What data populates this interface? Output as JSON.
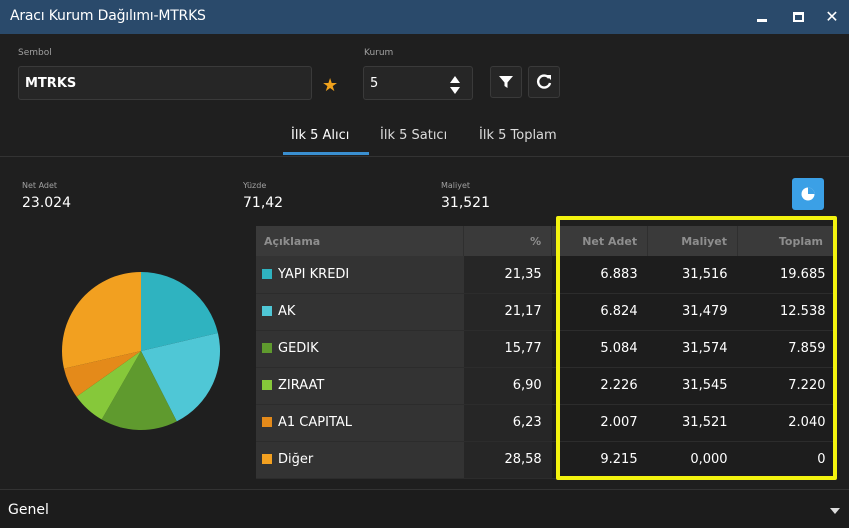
{
  "window": {
    "title": "Aracı Kurum Dağılımı-MTRKS"
  },
  "symbol": {
    "label": "Sembol",
    "value": "MTRKS"
  },
  "kurum": {
    "label": "Kurum",
    "value": "5"
  },
  "tabs": [
    {
      "label": "İlk 5 Alıcı",
      "active": true
    },
    {
      "label": "İlk 5 Satıcı",
      "active": false
    },
    {
      "label": "İlk 5 Toplam",
      "active": false
    }
  ],
  "stats": {
    "net_adet": {
      "label": "Net Adet",
      "value": "23.024"
    },
    "yuzde": {
      "label": "Yüzde",
      "value": "71,42"
    },
    "maliyet": {
      "label": "Maliyet",
      "value": "31,521"
    }
  },
  "table": {
    "headers": [
      "Açıklama",
      "%",
      "Net Adet",
      "Maliyet",
      "Toplam"
    ],
    "rows": [
      {
        "name": "YAPI KREDI",
        "pct": "21,35",
        "net": "6.883",
        "maliyet": "31,516",
        "toplam": "19.685",
        "color": "#2fb3c0"
      },
      {
        "name": "AK",
        "pct": "21,17",
        "net": "6.824",
        "maliyet": "31,479",
        "toplam": "12.538",
        "color": "#4fc7d6"
      },
      {
        "name": "GEDIK",
        "pct": "15,77",
        "net": "5.084",
        "maliyet": "31,574",
        "toplam": "7.859",
        "color": "#5f9a2e"
      },
      {
        "name": "ZIRAAT",
        "pct": "6,90",
        "net": "2.226",
        "maliyet": "31,545",
        "toplam": "7.220",
        "color": "#86c83a"
      },
      {
        "name": "A1 CAPITAL",
        "pct": "6,23",
        "net": "2.007",
        "maliyet": "31,521",
        "toplam": "2.040",
        "color": "#e48a1a"
      },
      {
        "name": "Diğer",
        "pct": "28,58",
        "net": "9.215",
        "maliyet": "0,000",
        "toplam": "0",
        "color": "#f2a020"
      }
    ]
  },
  "chart_data": {
    "type": "pie",
    "categories": [
      "YAPI KREDI",
      "AK",
      "GEDIK",
      "ZIRAAT",
      "A1 CAPITAL",
      "Diğer"
    ],
    "values": [
      21.35,
      21.17,
      15.77,
      6.9,
      6.23,
      28.58
    ],
    "colors": [
      "#2fb3c0",
      "#4fc7d6",
      "#5f9a2e",
      "#86c83a",
      "#e48a1a",
      "#f2a020"
    ]
  },
  "footer": {
    "label": "Genel"
  },
  "icons": {
    "favorite": "star-icon",
    "filter": "filter-icon",
    "refresh": "refresh-icon",
    "chart": "pie-chart-icon"
  }
}
